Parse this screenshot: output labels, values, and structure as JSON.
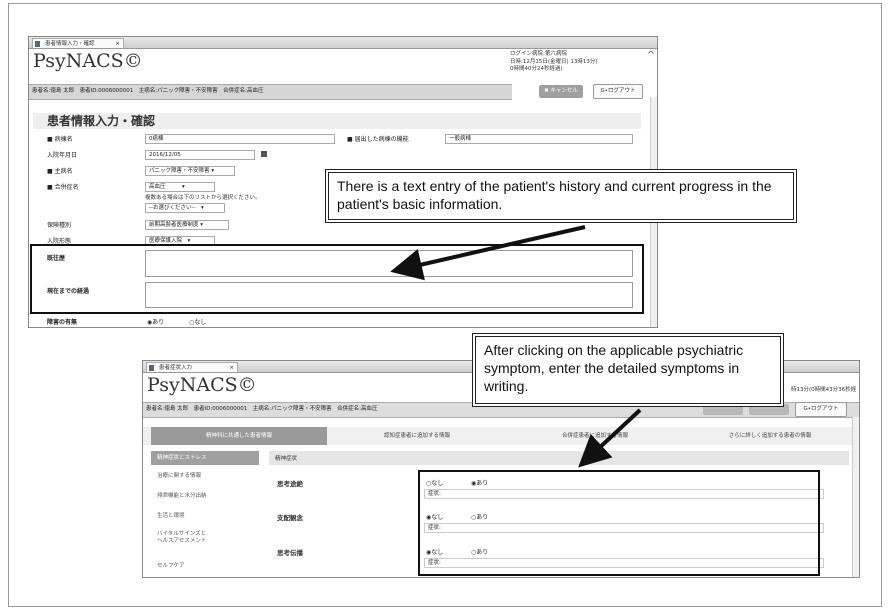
{
  "top": {
    "tab_title": "患者情報入力・確認",
    "tab_close": "×",
    "logo": "PsyNACS©",
    "login_line1": "ログイン病院:第六病院",
    "login_line2": "日時:12月15日(金曜日) 13時13分(",
    "login_line3": "0時間40分24秒経過)",
    "patient_bar": "患者名:徳島 太郎　患者ID:0006000001　主病名:パニック障害・不安障害　合併症名:高血圧",
    "cancel_label": "✖ キャンセル",
    "logout_label": "G•ログアウト",
    "section_title": "患者情報入力・確認",
    "fields": {
      "ward_label": "■ 病棟名",
      "ward_value": "0病棟",
      "reported_label": "■ 届出した病棟の機能",
      "reported_value": "一般病棟",
      "admit_label": "入院年月日",
      "admit_value": "2016/12/05",
      "main_label": "■ 主病名",
      "main_value": "パニック障害・不安障害 ▾",
      "comp_label": "■ 合併症名",
      "comp_value": "高血圧　　　▾",
      "comp_hint": "複数ある場合は下のリストから選択ください。",
      "comp_select": "--お選びください--　▾",
      "ins_label": "保険種別",
      "ins_value": "前期高齢者医療制度 ▾",
      "form_label": "入院形態",
      "form_value": "医療保護入院　▾",
      "history_label": "既往歴",
      "progress_label": "現在までの経過",
      "disability_label": "障害の有無",
      "disability_yes": "◉あり",
      "disability_no": "○なし"
    },
    "callout": "There is a text entry of the patient's history and current progress in the patient's basic information."
  },
  "bottom": {
    "tab_title": "患者症状入力",
    "tab_close": "×",
    "logo": "PsyNACS©",
    "time_text": "時13分(0時間43分36秒経",
    "patient_bar": "患者名:徳島 太郎　患者ID:0006000001　主病名:パニック障害・不安障害　合併症名:高血圧",
    "logout_label": "G•ログアウト",
    "nav_tabs": [
      "精神科に共通した患者情報",
      "認知症患者に追加する情報",
      "合併症患者に追加する情報",
      "さらに詳しく追加する患者の情報"
    ],
    "side_items": [
      "精神症状とストレス",
      "治療に関する情報",
      "排泄機能と水分出納",
      "生活と環境",
      "バイタルサインズと\nヘルスアセスメント",
      "セルフケア"
    ],
    "panel_header": "精神症状",
    "symptoms": [
      {
        "label": "思考途絶",
        "opt_no": "○なし",
        "opt_yes": "◉あり",
        "note": "症状:"
      },
      {
        "label": "支配観念",
        "opt_no": "◉なし",
        "opt_yes": "○あり",
        "note": "症状:"
      },
      {
        "label": "思考伝播",
        "opt_no": "◉なし",
        "opt_yes": "○あり",
        "note": "症状:"
      }
    ],
    "callout": "After clicking on the applicable psychiatric symptom, enter the detailed symptoms in writing."
  }
}
